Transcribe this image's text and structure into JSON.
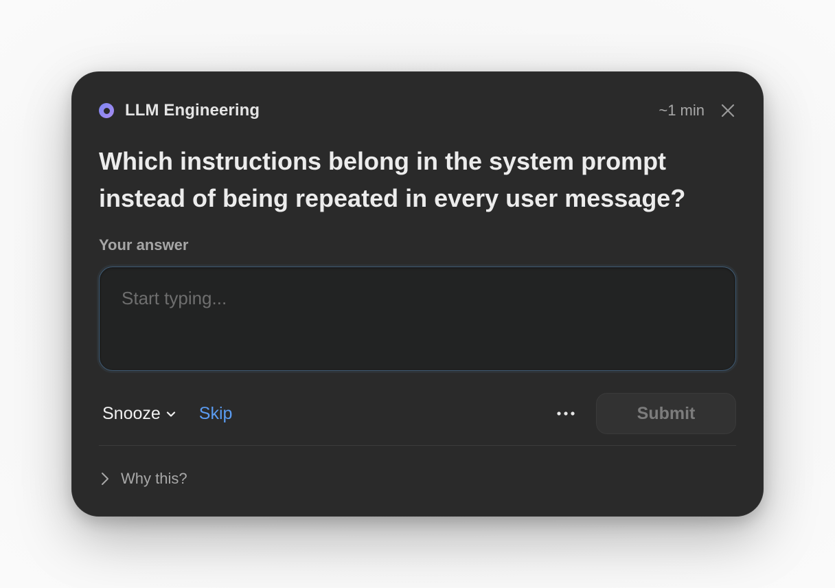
{
  "card": {
    "topic": "LLM Engineering",
    "duration": "~1 min",
    "question": "Which instructions belong in the system prompt instead of being repeated in every user message?",
    "answer_label": "Your answer",
    "answer": {
      "value": "",
      "placeholder": "Start typing..."
    },
    "actions": {
      "snooze_label": "Snooze",
      "skip_label": "Skip",
      "submit_label": "Submit"
    },
    "why_label": "Why this?"
  },
  "icons": {
    "brand": "topic-dot-icon",
    "close": "close-icon",
    "snooze_dropdown": "chevron-down-icon",
    "more": "more-horizontal-icon",
    "disclosure": "chevron-right-icon"
  },
  "colors": {
    "card_bg": "#2a2a2a",
    "accent_link": "#5b9cf2",
    "brand_gradient_start": "#7d86f2",
    "brand_gradient_end": "#a88cf0",
    "input_border": "#3f5a73"
  }
}
